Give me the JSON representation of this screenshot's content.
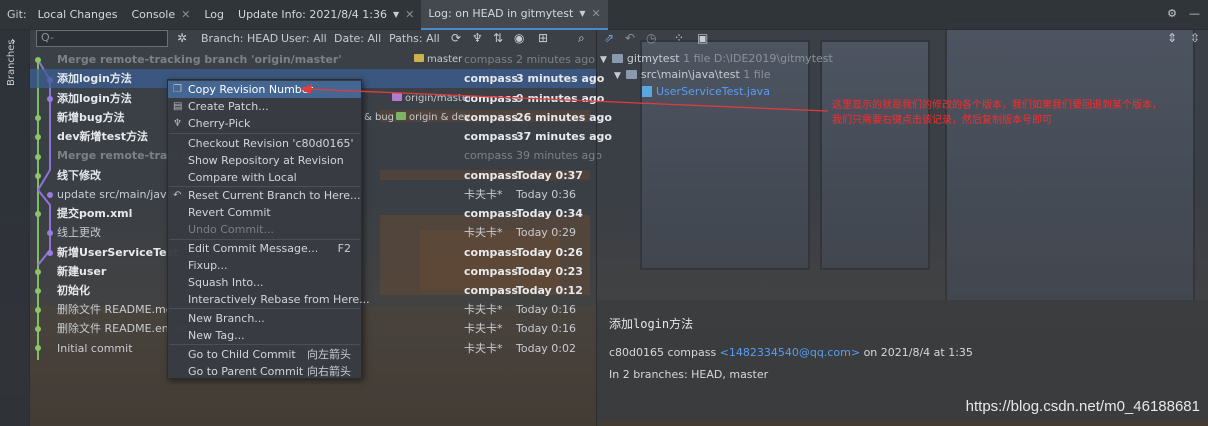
{
  "tabs": {
    "git_label": "Git:",
    "local_changes": "Local Changes",
    "console": "Console",
    "log": "Log",
    "update_info": "Update Info: 2021/8/4 1:36",
    "log_head": "Log: on HEAD in gitmytest"
  },
  "strip": {
    "label": "Branches"
  },
  "toolbar": {
    "search_placeholder": "Q-",
    "branch": "Branch: HEAD",
    "user": "User: All",
    "date": "Date: All",
    "paths": "Paths: All"
  },
  "commits": [
    {
      "message": "Merge remote-tracking branch 'origin/master'",
      "author": "compass",
      "date": "2 minutes ago",
      "style": "dim",
      "tag": "master"
    },
    {
      "message": "添加login方法",
      "author": "compass",
      "date": "3 minutes ago",
      "style": "bold"
    },
    {
      "message": "添加login方法",
      "author": "compass",
      "date": "9 minutes ago",
      "style": "bold",
      "tag": "origin/master"
    },
    {
      "message": "新增bug方法",
      "author": "compass",
      "date": "26 minutes ago",
      "style": "bold",
      "tag": "origin & dev"
    },
    {
      "message": "dev新增test方法",
      "author": "compass",
      "date": "37 minutes ago",
      "style": "bold"
    },
    {
      "message": "Merge remote-tracking",
      "author": "compass",
      "date": "39 minutes ago",
      "style": "dim"
    },
    {
      "message": "线下修改",
      "author": "compass",
      "date": "Today 0:37",
      "style": "bold"
    },
    {
      "message": "update src/main/java/te",
      "author": "卡夫卡*",
      "date": "Today 0:36",
      "style": "normal"
    },
    {
      "message": "提交pom.xml",
      "author": "compass",
      "date": "Today 0:34",
      "style": "bold"
    },
    {
      "message": "线上更改",
      "author": "卡夫卡*",
      "date": "Today 0:29",
      "style": "normal"
    },
    {
      "message": "新增UserServiceTest",
      "author": "compass",
      "date": "Today 0:26",
      "style": "bold"
    },
    {
      "message": "新建user",
      "author": "compass",
      "date": "Today 0:23",
      "style": "bold"
    },
    {
      "message": "初始化",
      "author": "compass",
      "date": "Today 0:12",
      "style": "bold"
    },
    {
      "message": "删除文件 README.md",
      "author": "卡夫卡*",
      "date": "Today 0:16",
      "style": "normal"
    },
    {
      "message": "删除文件 README.en.mc",
      "author": "卡夫卡*",
      "date": "Today 0:16",
      "style": "normal"
    },
    {
      "message": "Initial commit",
      "author": "卡夫卡*",
      "date": "Today 0:02",
      "style": "normal"
    }
  ],
  "extra_tag": "& bug",
  "menu": {
    "copy_revision": "Copy Revision Number",
    "create_patch": "Create Patch...",
    "cherry_pick": "Cherry-Pick",
    "checkout_revision": "Checkout Revision 'c80d0165'",
    "show_repo": "Show Repository at Revision",
    "compare_local": "Compare with Local",
    "reset_branch": "Reset Current Branch to Here...",
    "revert_commit": "Revert Commit",
    "undo_commit": "Undo Commit...",
    "edit_message": "Edit Commit Message...",
    "edit_message_shortcut": "F2",
    "fixup": "Fixup...",
    "squash": "Squash Into...",
    "rebase": "Interactively Rebase from Here...",
    "new_branch": "New Branch...",
    "new_tag": "New Tag...",
    "go_child": "Go to Child Commit",
    "go_child_shortcut": "向左箭头",
    "go_parent": "Go to Parent Commit",
    "go_parent_shortcut": "向右箭头"
  },
  "tree": {
    "root": "gitmytest",
    "root_meta": "1 file  D:\\IDE2019\\gitmytest",
    "folder": "src\\main\\java\\test",
    "folder_meta": "1 file",
    "file": "UserServiceTest.java"
  },
  "annotation": {
    "line1": "这里显示的就是我们的修改的各个版本，我们如果我们要回退到某个版本，",
    "line2": "我们只需要右键点击该记录，然后复制版本号即可"
  },
  "details": {
    "title": "添加login方法",
    "hash_author": "c80d0165 compass",
    "email": "<1482334540@qq.com>",
    "date_text": "on 2021/8/4 at 1:35",
    "branches": "In 2 branches: HEAD, master"
  },
  "watermark": "https://blog.csdn.net/m0_46188681",
  "colors": {
    "accent": "#4a88c7",
    "selection": "#3c5f91",
    "annotation": "#ff2a2a",
    "link": "#589df6"
  }
}
